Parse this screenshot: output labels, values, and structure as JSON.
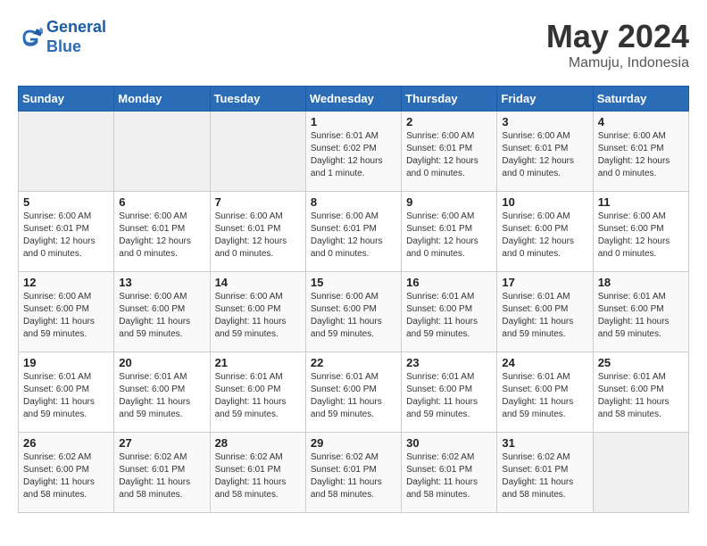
{
  "header": {
    "logo_line1": "General",
    "logo_line2": "Blue",
    "title": "May 2024",
    "subtitle": "Mamuju, Indonesia"
  },
  "weekdays": [
    "Sunday",
    "Monday",
    "Tuesday",
    "Wednesday",
    "Thursday",
    "Friday",
    "Saturday"
  ],
  "weeks": [
    [
      {
        "day": "",
        "info": ""
      },
      {
        "day": "",
        "info": ""
      },
      {
        "day": "",
        "info": ""
      },
      {
        "day": "1",
        "info": "Sunrise: 6:01 AM\nSunset: 6:02 PM\nDaylight: 12 hours\nand 1 minute."
      },
      {
        "day": "2",
        "info": "Sunrise: 6:00 AM\nSunset: 6:01 PM\nDaylight: 12 hours\nand 0 minutes."
      },
      {
        "day": "3",
        "info": "Sunrise: 6:00 AM\nSunset: 6:01 PM\nDaylight: 12 hours\nand 0 minutes."
      },
      {
        "day": "4",
        "info": "Sunrise: 6:00 AM\nSunset: 6:01 PM\nDaylight: 12 hours\nand 0 minutes."
      }
    ],
    [
      {
        "day": "5",
        "info": "Sunrise: 6:00 AM\nSunset: 6:01 PM\nDaylight: 12 hours\nand 0 minutes."
      },
      {
        "day": "6",
        "info": "Sunrise: 6:00 AM\nSunset: 6:01 PM\nDaylight: 12 hours\nand 0 minutes."
      },
      {
        "day": "7",
        "info": "Sunrise: 6:00 AM\nSunset: 6:01 PM\nDaylight: 12 hours\nand 0 minutes."
      },
      {
        "day": "8",
        "info": "Sunrise: 6:00 AM\nSunset: 6:01 PM\nDaylight: 12 hours\nand 0 minutes."
      },
      {
        "day": "9",
        "info": "Sunrise: 6:00 AM\nSunset: 6:01 PM\nDaylight: 12 hours\nand 0 minutes."
      },
      {
        "day": "10",
        "info": "Sunrise: 6:00 AM\nSunset: 6:00 PM\nDaylight: 12 hours\nand 0 minutes."
      },
      {
        "day": "11",
        "info": "Sunrise: 6:00 AM\nSunset: 6:00 PM\nDaylight: 12 hours\nand 0 minutes."
      }
    ],
    [
      {
        "day": "12",
        "info": "Sunrise: 6:00 AM\nSunset: 6:00 PM\nDaylight: 11 hours\nand 59 minutes."
      },
      {
        "day": "13",
        "info": "Sunrise: 6:00 AM\nSunset: 6:00 PM\nDaylight: 11 hours\nand 59 minutes."
      },
      {
        "day": "14",
        "info": "Sunrise: 6:00 AM\nSunset: 6:00 PM\nDaylight: 11 hours\nand 59 minutes."
      },
      {
        "day": "15",
        "info": "Sunrise: 6:00 AM\nSunset: 6:00 PM\nDaylight: 11 hours\nand 59 minutes."
      },
      {
        "day": "16",
        "info": "Sunrise: 6:01 AM\nSunset: 6:00 PM\nDaylight: 11 hours\nand 59 minutes."
      },
      {
        "day": "17",
        "info": "Sunrise: 6:01 AM\nSunset: 6:00 PM\nDaylight: 11 hours\nand 59 minutes."
      },
      {
        "day": "18",
        "info": "Sunrise: 6:01 AM\nSunset: 6:00 PM\nDaylight: 11 hours\nand 59 minutes."
      }
    ],
    [
      {
        "day": "19",
        "info": "Sunrise: 6:01 AM\nSunset: 6:00 PM\nDaylight: 11 hours\nand 59 minutes."
      },
      {
        "day": "20",
        "info": "Sunrise: 6:01 AM\nSunset: 6:00 PM\nDaylight: 11 hours\nand 59 minutes."
      },
      {
        "day": "21",
        "info": "Sunrise: 6:01 AM\nSunset: 6:00 PM\nDaylight: 11 hours\nand 59 minutes."
      },
      {
        "day": "22",
        "info": "Sunrise: 6:01 AM\nSunset: 6:00 PM\nDaylight: 11 hours\nand 59 minutes."
      },
      {
        "day": "23",
        "info": "Sunrise: 6:01 AM\nSunset: 6:00 PM\nDaylight: 11 hours\nand 59 minutes."
      },
      {
        "day": "24",
        "info": "Sunrise: 6:01 AM\nSunset: 6:00 PM\nDaylight: 11 hours\nand 59 minutes."
      },
      {
        "day": "25",
        "info": "Sunrise: 6:01 AM\nSunset: 6:00 PM\nDaylight: 11 hours\nand 58 minutes."
      }
    ],
    [
      {
        "day": "26",
        "info": "Sunrise: 6:02 AM\nSunset: 6:00 PM\nDaylight: 11 hours\nand 58 minutes."
      },
      {
        "day": "27",
        "info": "Sunrise: 6:02 AM\nSunset: 6:01 PM\nDaylight: 11 hours\nand 58 minutes."
      },
      {
        "day": "28",
        "info": "Sunrise: 6:02 AM\nSunset: 6:01 PM\nDaylight: 11 hours\nand 58 minutes."
      },
      {
        "day": "29",
        "info": "Sunrise: 6:02 AM\nSunset: 6:01 PM\nDaylight: 11 hours\nand 58 minutes."
      },
      {
        "day": "30",
        "info": "Sunrise: 6:02 AM\nSunset: 6:01 PM\nDaylight: 11 hours\nand 58 minutes."
      },
      {
        "day": "31",
        "info": "Sunrise: 6:02 AM\nSunset: 6:01 PM\nDaylight: 11 hours\nand 58 minutes."
      },
      {
        "day": "",
        "info": ""
      }
    ]
  ]
}
